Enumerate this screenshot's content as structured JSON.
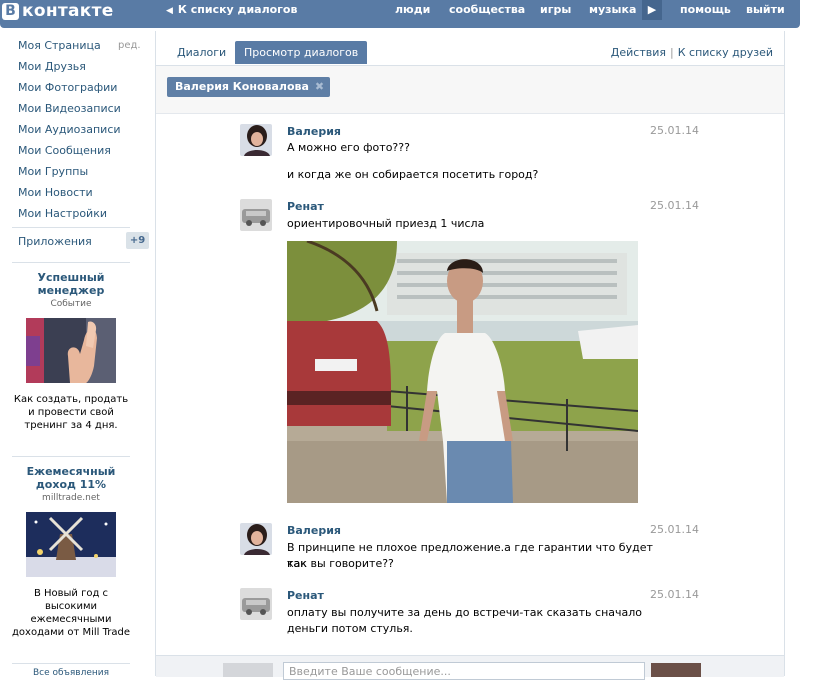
{
  "header": {
    "logo_letter": "B",
    "logo_text": "контакте",
    "back_link": "К списку диалогов",
    "nav": [
      "люди",
      "сообщества",
      "игры",
      "музыка",
      "помощь",
      "выйти"
    ]
  },
  "sidebar": {
    "items": [
      {
        "label": "Моя Страница"
      },
      {
        "label": "Мои Друзья"
      },
      {
        "label": "Мои Фотографии"
      },
      {
        "label": "Мои Видеозаписи"
      },
      {
        "label": "Мои Аудиозаписи"
      },
      {
        "label": "Мои Сообщения"
      },
      {
        "label": "Мои Группы"
      },
      {
        "label": "Мои Новости"
      },
      {
        "label": "Мои Настройки"
      }
    ],
    "edit_label": "ред.",
    "apps_label": "Приложения",
    "apps_count": "+9"
  },
  "ads": [
    {
      "title": "Успешный менеджер",
      "subtitle": "Событие",
      "text": "Как создать, продать и провести свой тренинг за 4 дня."
    },
    {
      "title": "Ежемесячный доход 11%",
      "subtitle": "milltrade.net",
      "text": "В Новый год с высокими ежемесячными доходами от Mill Trade"
    }
  ],
  "all_ads_label": "Все объявления",
  "tabs": {
    "dialogs": "Диалоги",
    "view_dialogs": "Просмотр диалогов",
    "actions": "Действия",
    "to_friends": "К списку друзей"
  },
  "filter": {
    "chip_label": "Валерия Коновалова"
  },
  "messages": [
    {
      "author": "Валерия",
      "date": "25.01.14",
      "lines": [
        "А можно его фото???",
        "и когда же он собирается посетить город?"
      ]
    },
    {
      "author": "Ренат",
      "date": "25.01.14",
      "lines": [
        "ориентировочный приезд 1 числа"
      ]
    },
    {
      "author": "Валерия",
      "date": "25.01.14",
      "lines": [
        "В принципе не плохое предложение.а где гарантии что будет так",
        "как вы говорите??"
      ]
    },
    {
      "author": "Ренат",
      "date": "25.01.14",
      "lines": [
        "оплату вы получите за день до встречи-так сказать сначало",
        "деньги потом стулья."
      ]
    }
  ],
  "composer": {
    "placeholder": "Введите Ваше сообщение..."
  },
  "colors": {
    "brand": "#597ba5",
    "link": "#2b587a",
    "muted": "#999999"
  }
}
